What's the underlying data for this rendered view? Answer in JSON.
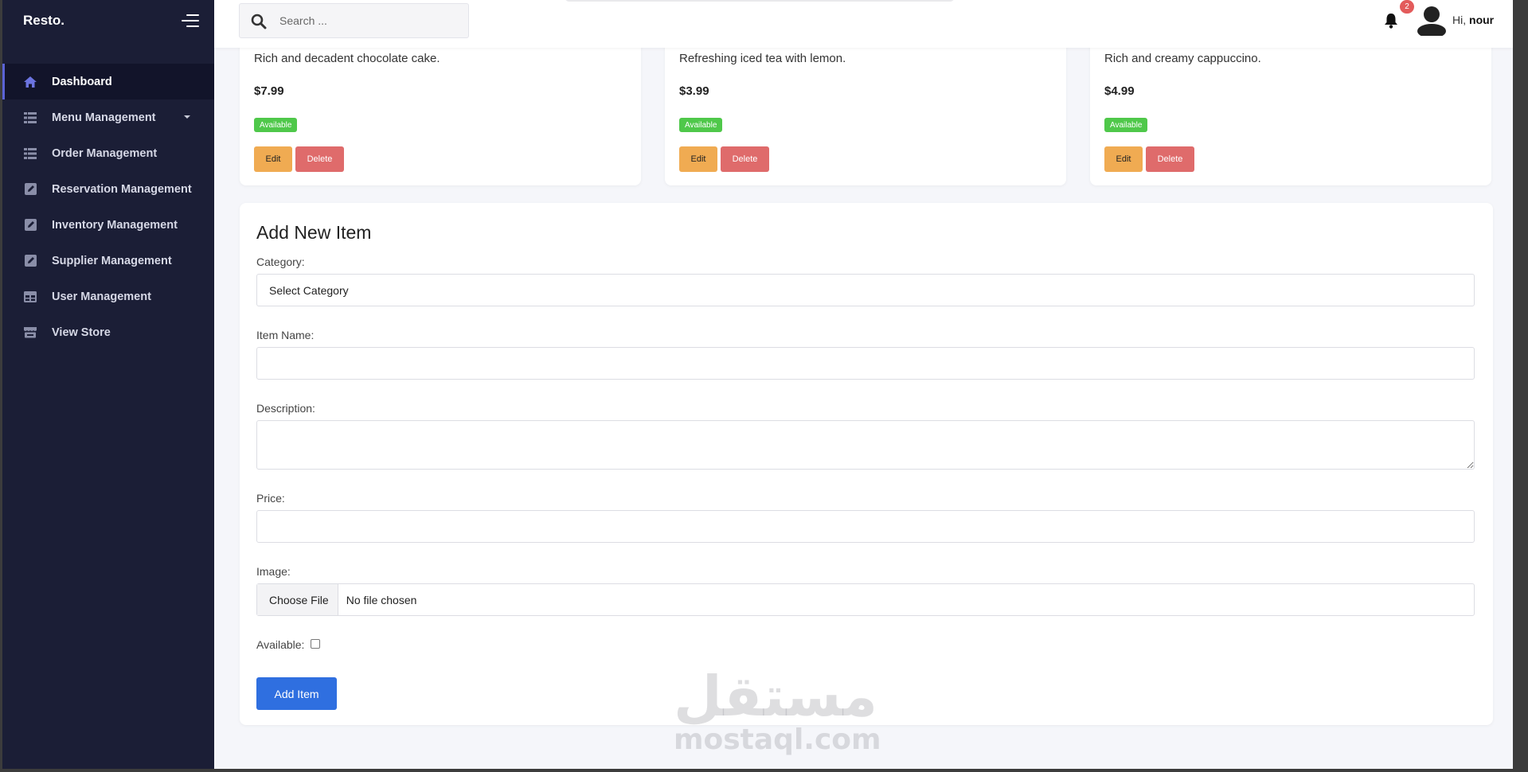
{
  "app": {
    "brand": "Resto."
  },
  "sidebar": {
    "items": [
      {
        "label": "Dashboard",
        "icon": "home-icon",
        "active": true
      },
      {
        "label": "Menu Management",
        "icon": "list-icon",
        "has_dropdown": true
      },
      {
        "label": "Order Management",
        "icon": "list-icon"
      },
      {
        "label": "Reservation Management",
        "icon": "edit-icon"
      },
      {
        "label": "Inventory Management",
        "icon": "edit-icon"
      },
      {
        "label": "Supplier Management",
        "icon": "edit-icon"
      },
      {
        "label": "User Management",
        "icon": "table-icon"
      },
      {
        "label": "View Store",
        "icon": "store-icon"
      }
    ]
  },
  "topbar": {
    "search_placeholder": "Search ...",
    "notification_count": "2",
    "greeting_prefix": "Hi,",
    "username": "nour"
  },
  "products": [
    {
      "description": "Rich and decadent chocolate cake.",
      "price": "$7.99",
      "status": "Available",
      "edit_label": "Edit",
      "delete_label": "Delete"
    },
    {
      "description": "Refreshing iced tea with lemon.",
      "price": "$3.99",
      "status": "Available",
      "edit_label": "Edit",
      "delete_label": "Delete"
    },
    {
      "description": "Rich and creamy cappuccino.",
      "price": "$4.99",
      "status": "Available",
      "edit_label": "Edit",
      "delete_label": "Delete"
    }
  ],
  "form": {
    "title": "Add New Item",
    "category_label": "Category:",
    "category_value": "Select Category",
    "name_label": "Item Name:",
    "description_label": "Description:",
    "price_label": "Price:",
    "image_label": "Image:",
    "file_button": "Choose File",
    "file_status": "No file chosen",
    "available_label": "Available:",
    "submit_label": "Add Item"
  },
  "watermark": {
    "logo": "مستقل",
    "url": "mostaql.com"
  },
  "colors": {
    "sidebar": "#1b1e36",
    "accent": "#2f6fe0",
    "available": "#4fc84a",
    "edit": "#f0ab52",
    "delete": "#df6b6b"
  }
}
